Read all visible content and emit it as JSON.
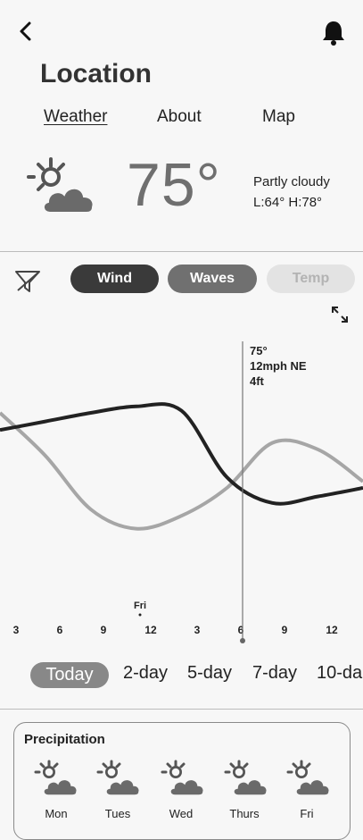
{
  "header": {
    "title": "Location",
    "tabs": [
      {
        "label": "Weather",
        "active": true
      },
      {
        "label": "About",
        "active": false
      },
      {
        "label": "Map",
        "active": false
      }
    ]
  },
  "current": {
    "icon": "partly-cloudy-icon",
    "temperature": "75°",
    "condition": "Partly cloudy",
    "low_high": "L:64° H:78°"
  },
  "toggles": {
    "wind": "Wind",
    "waves": "Waves",
    "temp": "Temp"
  },
  "chart_data": {
    "type": "line",
    "tooltip": {
      "temp": "75°",
      "wind": "12mph NE",
      "waves": "4ft"
    },
    "day_label": "Fri",
    "x_ticks": [
      "3",
      "6",
      "9",
      "12",
      "3",
      "6",
      "9",
      "12"
    ],
    "series": [
      {
        "color": "#222222",
        "values": [
          0.62,
          0.66,
          0.7,
          0.73,
          0.71,
          0.4,
          0.28,
          0.31,
          0.35
        ]
      },
      {
        "color": "#a6a6a6",
        "values": [
          0.7,
          0.5,
          0.25,
          0.16,
          0.22,
          0.35,
          0.56,
          0.53,
          0.38
        ]
      }
    ]
  },
  "ranges": [
    "Today",
    "2-day",
    "5-day",
    "7-day",
    "10-da"
  ],
  "precipitation": {
    "title": "Precipitation",
    "days": [
      "Mon",
      "Tues",
      "Wed",
      "Thurs",
      "Fri"
    ]
  },
  "colors": {
    "accent_dark": "#3a3a3a",
    "accent_mid": "#707070",
    "disabled": "#e3e3e3"
  }
}
